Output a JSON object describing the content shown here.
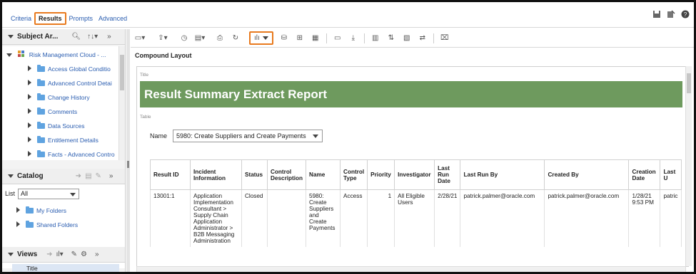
{
  "tabs": [
    "Criteria",
    "Results",
    "Prompts",
    "Advanced"
  ],
  "left": {
    "subject_title": "Subject Ar...",
    "tree_root": "Risk Management Cloud - ...",
    "tree_items": [
      "Access Global Conditio",
      "Advanced Control Detai",
      "Change History",
      "Comments",
      "Data Sources",
      "Entitlement Details",
      "Facts - Advanced Contro"
    ],
    "catalog_title": "Catalog",
    "list_label": "List",
    "list_value": "All",
    "catalog_folders": [
      "My Folders",
      "Shared Folders"
    ],
    "views_title": "Views",
    "views_item": "Title"
  },
  "main": {
    "compound_layout": "Compound Layout",
    "title_label": "Title",
    "report_title": "Result Summary Extract Report",
    "table_label": "Table",
    "name_label": "Name",
    "name_value": "5980: Create Suppliers and Create Payments"
  },
  "table": {
    "headers": [
      "Result ID",
      "Incident Information",
      "Status",
      "Control Description",
      "Name",
      "Control Type",
      "Priority",
      "Investigator",
      "Last Run Date",
      "Last Run By",
      "Created By",
      "Creation Date",
      "Last U"
    ],
    "row": [
      "13001:1",
      "Application Implementation Consultant > Supply Chain Application Administrator > B2B Messaging Administration",
      "Closed",
      "",
      "5980: Create Suppliers and Create Payments",
      "Access",
      "1",
      "All Eligible Users",
      "2/28/21",
      "patrick.palmer@oracle.com",
      "patrick.palmer@oracle.com",
      "1/28/21 9:53 PM",
      "patric"
    ]
  },
  "colors": {
    "accent": "#e87a1e",
    "banner": "#6e9a5e",
    "link": "#2a5db0"
  }
}
